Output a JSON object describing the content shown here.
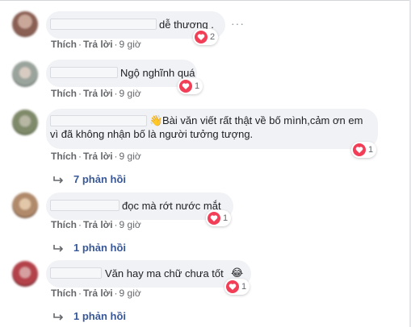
{
  "comments": [
    {
      "text": "dễ thương .",
      "reaction_count": "2",
      "actions": {
        "like": "Thích",
        "reply": "Trả lời",
        "time": "9 giờ"
      }
    },
    {
      "text": "Ngộ nghĩnh quá",
      "reaction_count": "1",
      "actions": {
        "like": "Thích",
        "reply": "Trả lời",
        "time": "9 giờ"
      }
    },
    {
      "text": "Bài văn viết rất thật về bố mình,cảm ơn em vì đã không nhận bố là người tưởng tượng.",
      "reaction_count": "1",
      "actions": {
        "like": "Thích",
        "reply": "Trả lời",
        "time": "9 giờ"
      },
      "replies_label": "7 phản hồi"
    },
    {
      "text": "đọc mà rớt nước mắt",
      "reaction_count": "1",
      "actions": {
        "like": "Thích",
        "reply": "Trả lời",
        "time": "9 giờ"
      },
      "replies_label": "1 phản hồi"
    },
    {
      "text": "Văn hay ma chữ chưa tốt",
      "reaction_count": "1",
      "actions": {
        "like": "Thích",
        "reply": "Trả lời",
        "time": "9 giờ"
      },
      "replies_label": "1 phản hồi"
    }
  ],
  "more_options": "···",
  "separator": "·",
  "icons": {
    "reaction": "heart-reaction-icon",
    "reply_arrow": "reply-arrow-icon",
    "wave_emoji": "waving-hand-icon",
    "laugh_emoji": "laughing-emoji-icon",
    "more": "more-options-icon"
  },
  "colors": {
    "bubble": "#f0f2f5",
    "heart": "#f33e58",
    "link": "#385898",
    "meta": "#65676b"
  }
}
